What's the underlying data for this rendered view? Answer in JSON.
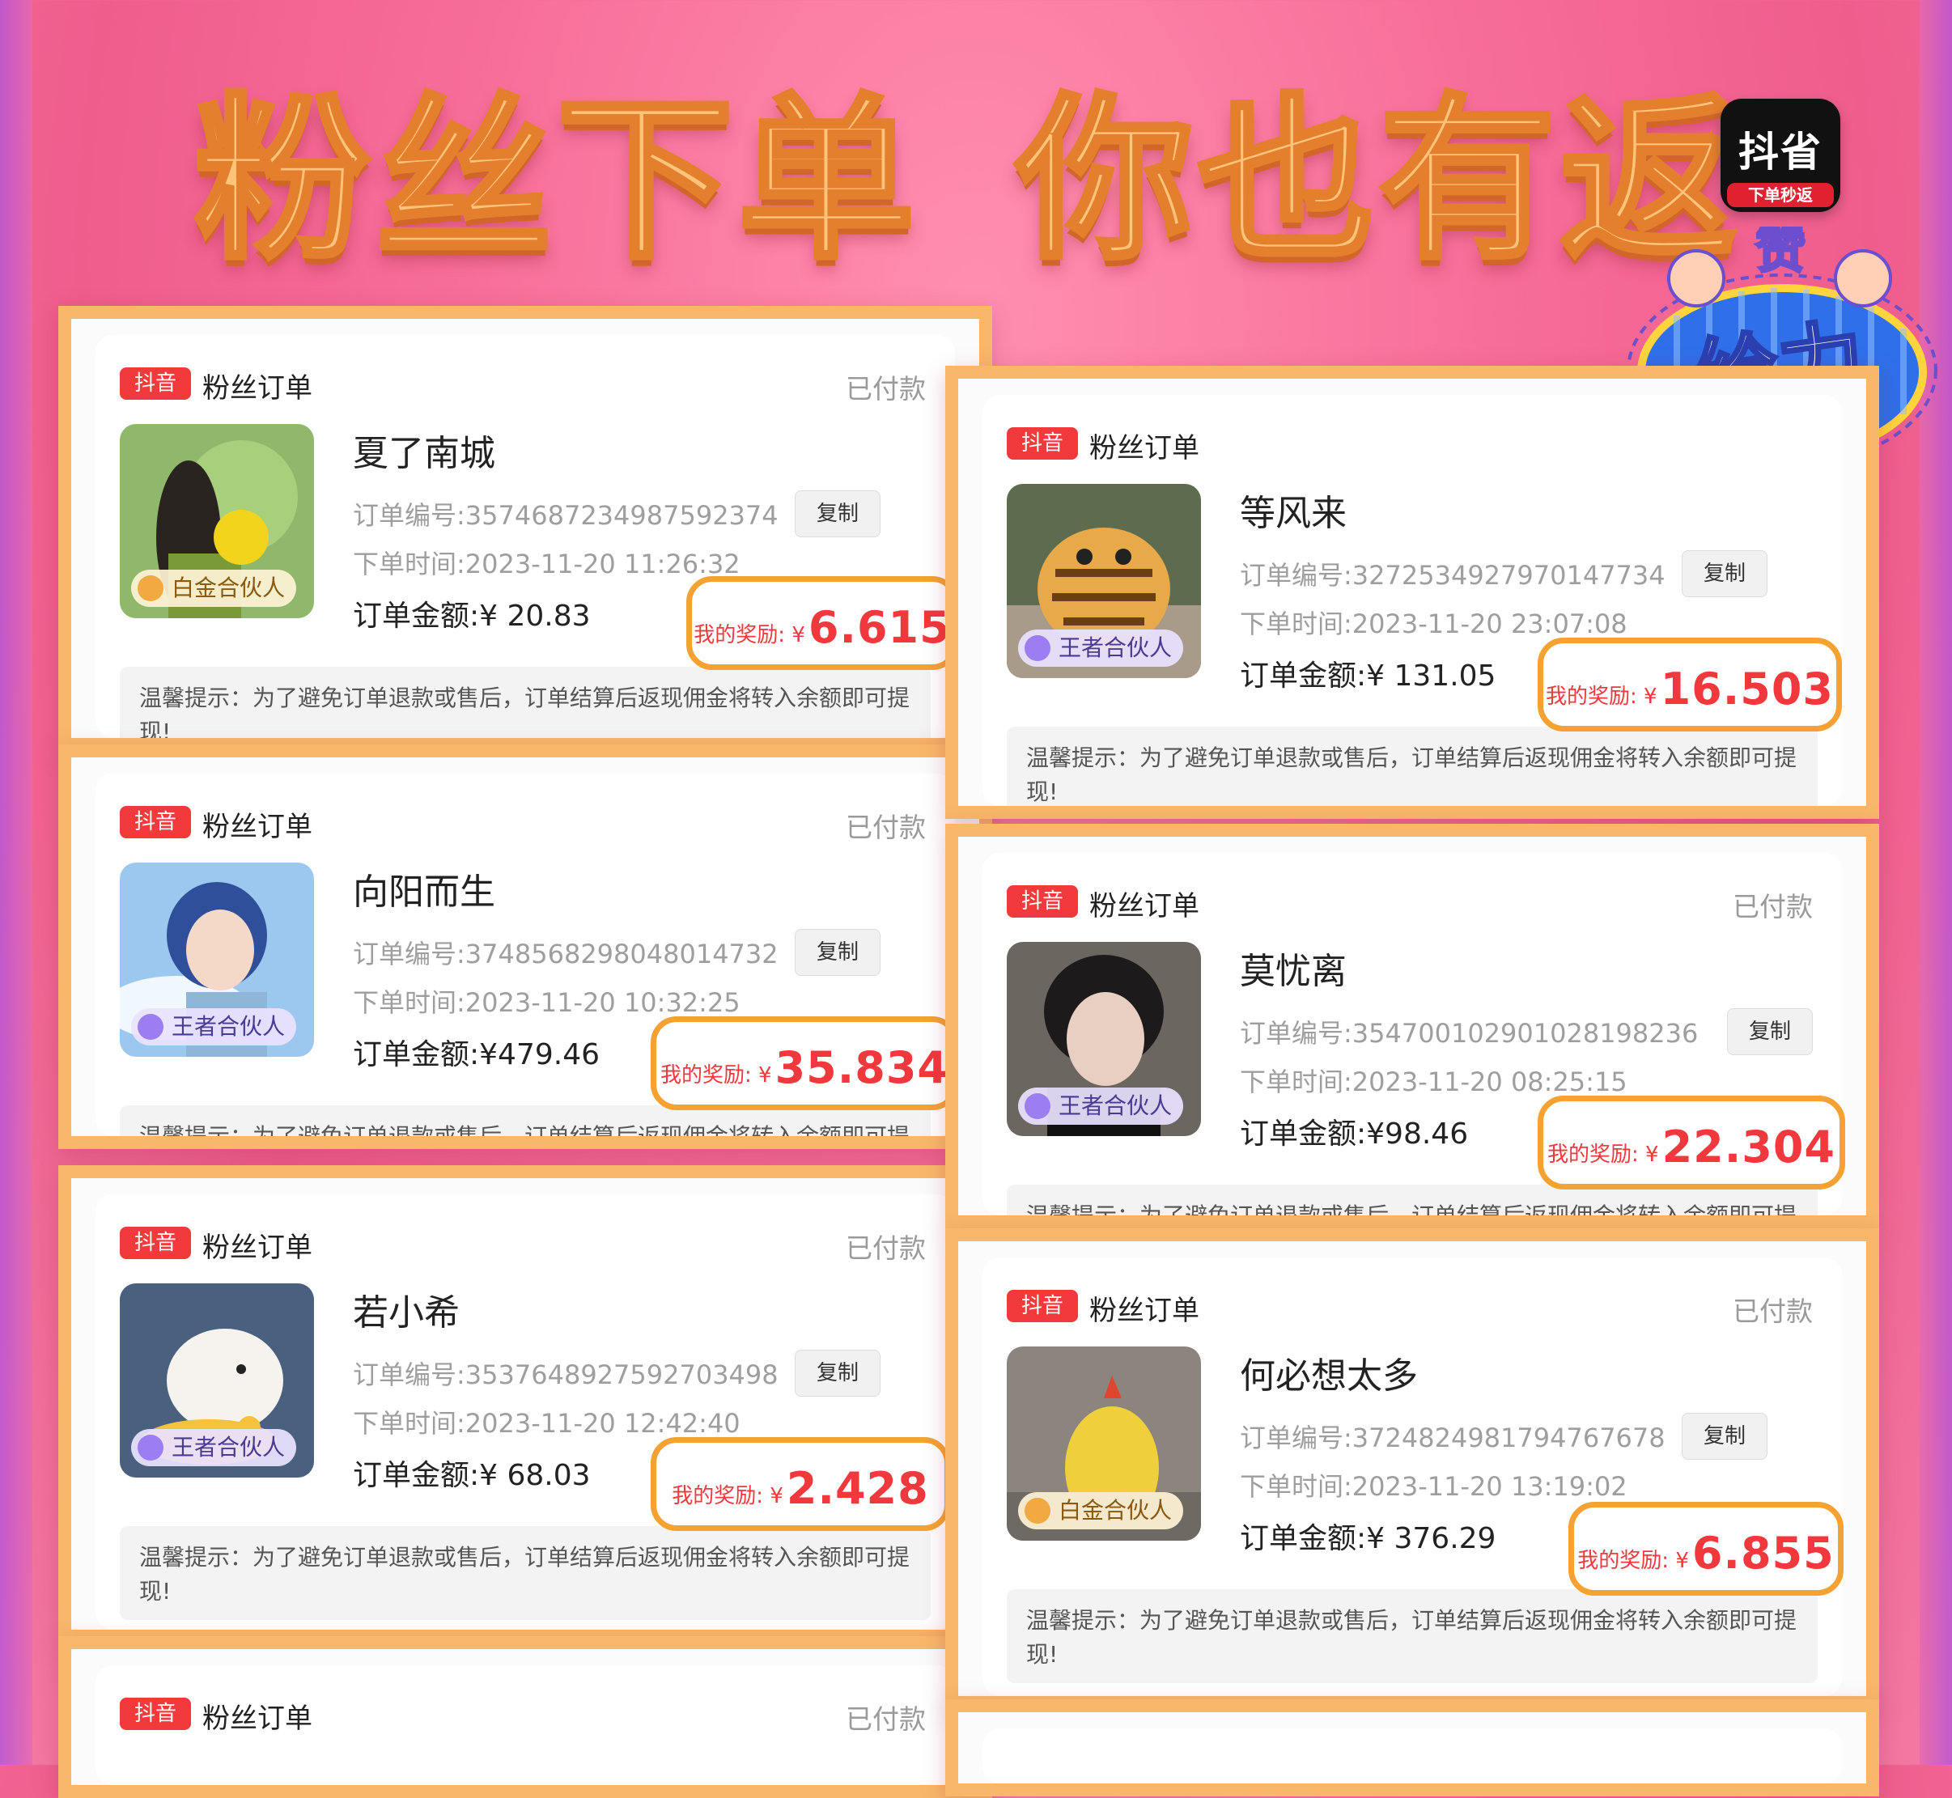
{
  "headline": {
    "part1": "粉丝下单",
    "part2": "你也有返"
  },
  "app_logo": {
    "name": "抖省",
    "subtitle": "下单秒返"
  },
  "badge": {
    "top": "赞",
    "main": "给力"
  },
  "copy_label": "复制",
  "tag_label": "抖音",
  "card_title": "粉丝订单",
  "order_no_prefix": "订单编号:",
  "order_time_prefix": "下单时间:",
  "amount_prefix": "订单金额:",
  "reward_label": "我的奖励: ¥",
  "tip_text": "温馨提示：为了避免订单退款或售后，订单结算后返现佣金将转入余额即可提现!",
  "cards": [
    {
      "status": "已付款",
      "name": "夏了南城",
      "order_no": "3574687234987592374",
      "time": "2023-11-20 11:26:32",
      "amount": "¥ 20.83",
      "reward": "6.615",
      "level": "白金合伙人",
      "level_type": "gold",
      "avatar": "avatar-girl-flowers"
    },
    {
      "status": "已付款",
      "name": "等风来",
      "order_no": "3272534927970147734",
      "time": "2023-11-20 23:07:08",
      "amount": "¥ 131.05",
      "reward": "16.503",
      "level": "王者合伙人",
      "level_type": "king",
      "avatar": "avatar-tiger-plush"
    },
    {
      "status": "已付款",
      "name": "向阳而生",
      "order_no": "3748568298048014732",
      "time": "2023-11-20 10:32:25",
      "amount": "¥479.46",
      "reward": "35.834",
      "level": "王者合伙人",
      "level_type": "king",
      "avatar": "avatar-anime-boy"
    },
    {
      "status": "已付款",
      "name": "莫忧离",
      "order_no": "3547001029010281982​36",
      "time": "2023-11-20 08:25:15",
      "amount": "¥98.46",
      "reward": "22.304",
      "level": "王者合伙人",
      "level_type": "king",
      "avatar": "avatar-young-man"
    },
    {
      "status": "已付款",
      "name": "若小希",
      "order_no": "3537648927592703498",
      "time": "2023-11-20 12:42:40",
      "amount": "¥ 68.03",
      "reward": "2.428",
      "level": "王者合伙人",
      "level_type": "king",
      "avatar": "avatar-seal-duck"
    },
    {
      "status": "已付款",
      "name": "何必想太多",
      "order_no": "3724824981794767678",
      "time": "2023-11-20 13:19:02",
      "amount": "¥ 376.29",
      "reward": "6.855",
      "level": "白金合伙人",
      "level_type": "gold",
      "avatar": "avatar-chick-plush"
    },
    {
      "status": "已付款"
    }
  ],
  "colors": {
    "accent_red": "#f23a3c",
    "frame_orange": "#f8b769",
    "reward_border": "#f5a233",
    "bg_pink": "#f76d99"
  }
}
